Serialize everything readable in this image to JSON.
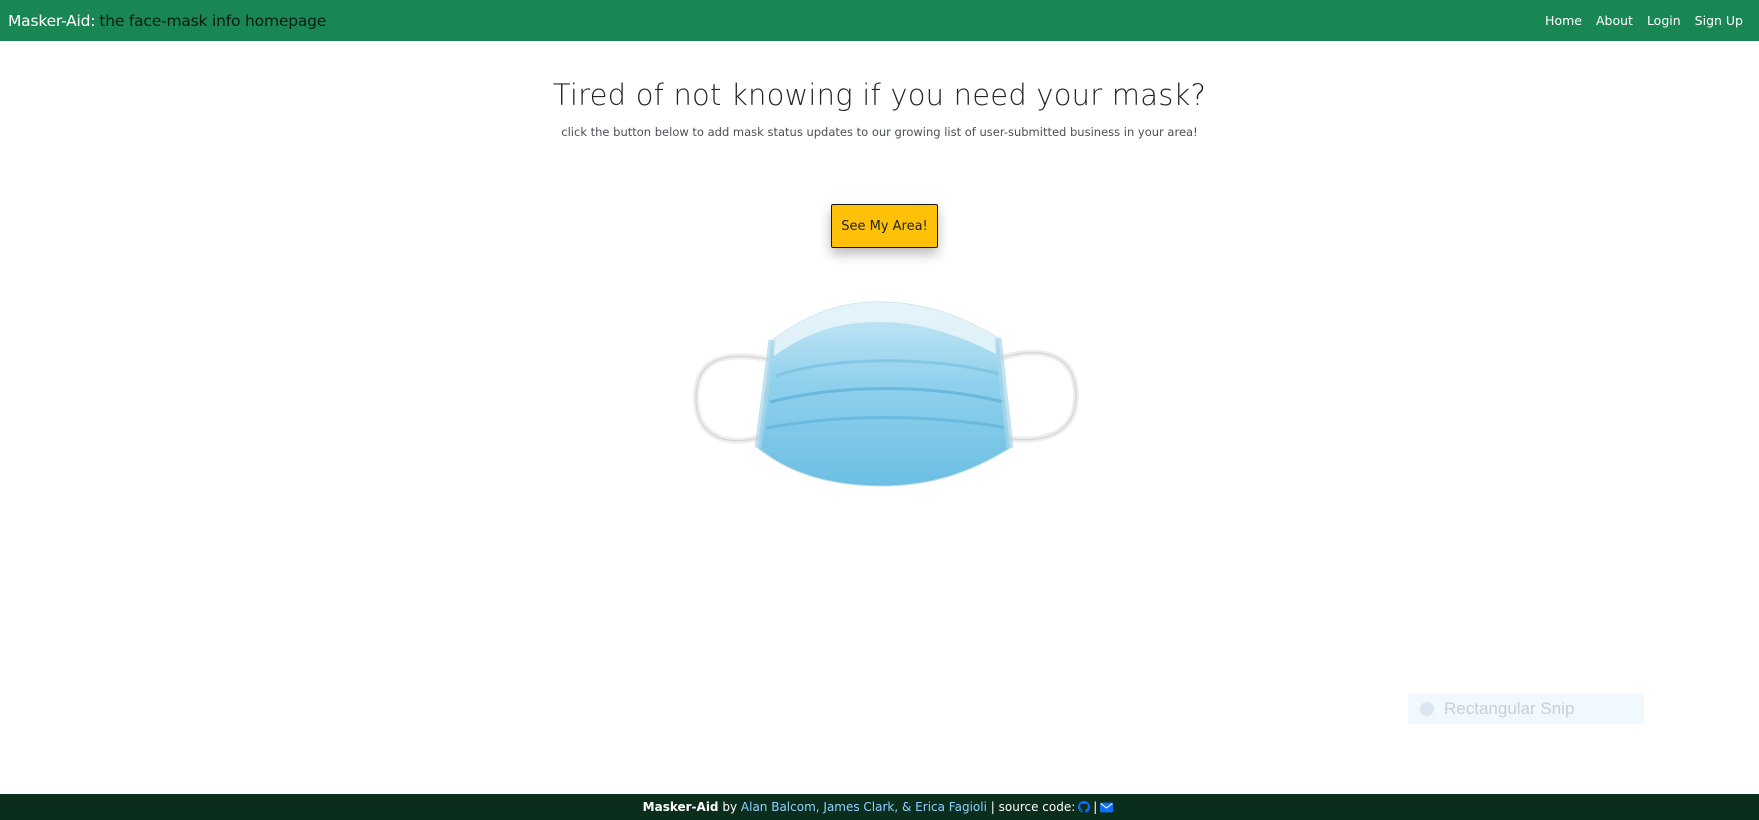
{
  "navbar": {
    "brand_name": "Masker-Aid:",
    "brand_tagline": "the face-mask info homepage",
    "links": [
      "Home",
      "About",
      "Login",
      "Sign Up"
    ]
  },
  "hero": {
    "title": "Tired of not knowing if you need your mask?",
    "subtitle": "click the button below to add mask status updates to our growing list of user-submitted business in your area!",
    "cta_label": "See My Area!"
  },
  "overlay": {
    "snip_label": "Rectangular Snip"
  },
  "footer": {
    "brand": "Masker-Aid",
    "by": "by",
    "authors": "Alan Balcom, James Clark, & Erica Fagioli",
    "separator": "|",
    "source_label": "source code:",
    "icons": [
      "github-icon",
      "envelope-icon"
    ]
  },
  "colors": {
    "navbar_bg": "#198754",
    "cta_bg": "#ffc107",
    "footer_bg": "#0b2e1c",
    "author_link": "#8fd0ff",
    "icon_blue": "#0d6efd"
  }
}
